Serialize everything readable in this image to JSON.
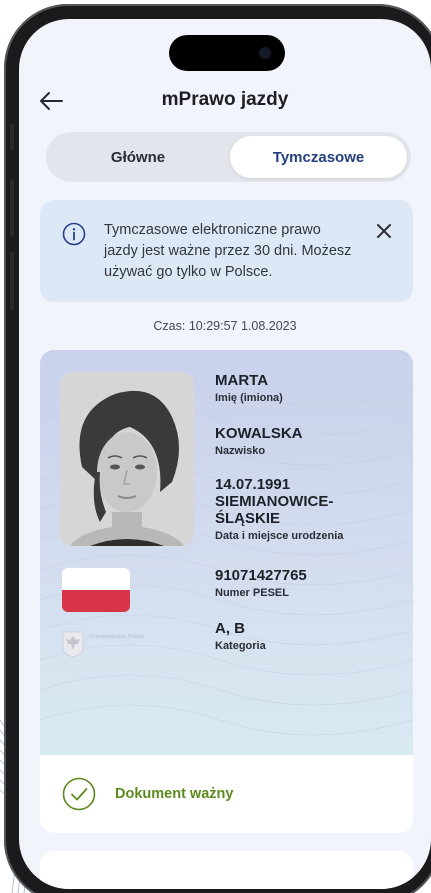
{
  "header": {
    "title": "mPrawo jazdy",
    "back_icon": "arrow-left-icon"
  },
  "tabs": [
    {
      "label": "Główne",
      "active": false
    },
    {
      "label": "Tymczasowe",
      "active": true
    }
  ],
  "info": {
    "icon": "info-icon",
    "text": "Tymczasowe elektroniczne prawo jazdy jest ważne przez 30 dni. Możesz używać go tylko w Polsce.",
    "close_icon": "close-icon"
  },
  "timestamp": "Czas: 10:29:57 1.08.2023",
  "document": {
    "fields": [
      {
        "value": "MARTA",
        "label": "Imię (imiona)"
      },
      {
        "value": "KOWALSKA",
        "label": "Nazwisko"
      },
      {
        "value": "14.07.1991\nSIEMIANOWICE-\nŚLĄSKIE",
        "label": "Data i miejsce urodzenia"
      },
      {
        "value": "91071427765",
        "label": "Numer PESEL"
      },
      {
        "value": "A, B",
        "label": "Kategoria"
      }
    ],
    "emblem_caption": "Rzeczpospolita Polska"
  },
  "status": {
    "icon": "check-circle-icon",
    "text": "Dokument ważny"
  },
  "colors": {
    "accent": "#25407e",
    "info_bg": "#dde8f7",
    "valid_green": "#5c8a1e",
    "flag_red": "#d7344a"
  }
}
